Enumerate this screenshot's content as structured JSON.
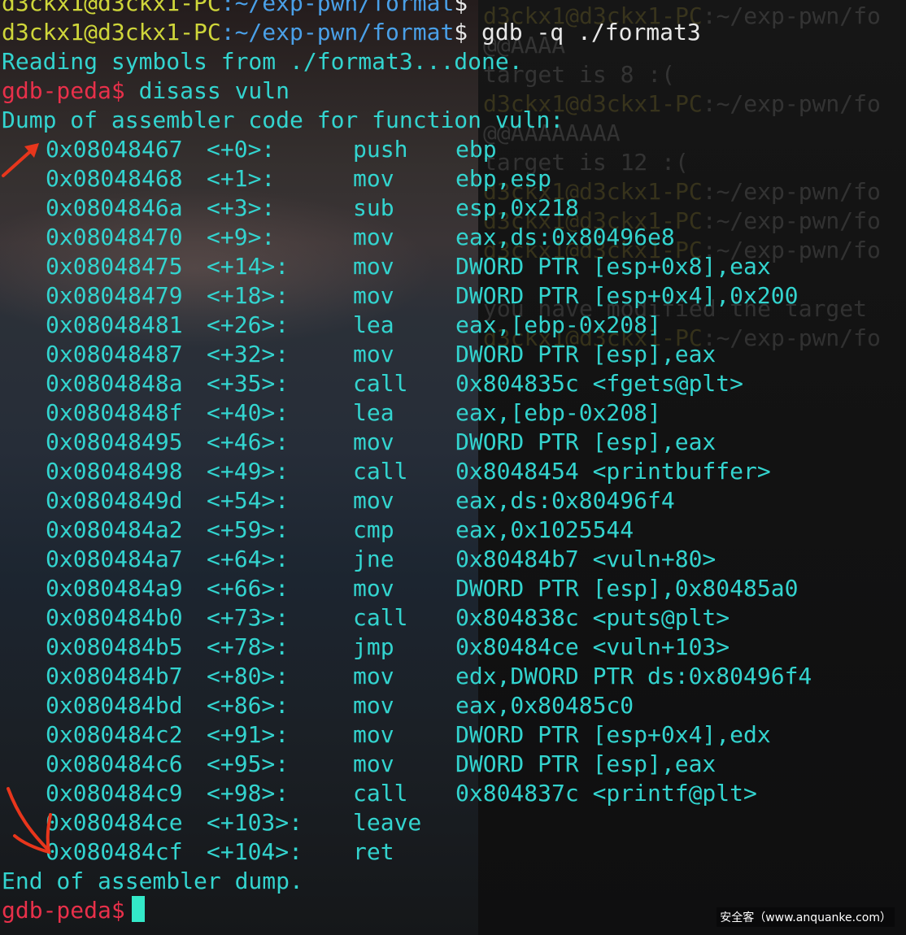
{
  "window": {
    "prev_prompt": {
      "user_host": "d3ckx1@d3ckx1-PC",
      "path": ":~/exp-pwn/format",
      "symbol": "$"
    }
  },
  "session": {
    "prompt": {
      "user_host": "d3ckx1@d3ckx1-PC",
      "path": ":~/exp-pwn/format",
      "symbol": "$"
    },
    "command": " gdb -q ./format3",
    "reading": "Reading symbols from ./format3...done.",
    "gdb_prompt": "gdb-peda$",
    "gdb_command": " disass vuln",
    "dump_header": "Dump of assembler code for function vuln:",
    "dump_footer": "End of assembler dump.",
    "instructions": [
      {
        "addr": "0x08048467",
        "off": "<+0>:",
        "op": "push",
        "args": "ebp"
      },
      {
        "addr": "0x08048468",
        "off": "<+1>:",
        "op": "mov",
        "args": "ebp,esp"
      },
      {
        "addr": "0x0804846a",
        "off": "<+3>:",
        "op": "sub",
        "args": "esp,0x218"
      },
      {
        "addr": "0x08048470",
        "off": "<+9>:",
        "op": "mov",
        "args": "eax,ds:0x80496e8"
      },
      {
        "addr": "0x08048475",
        "off": "<+14>:",
        "op": "mov",
        "args": "DWORD PTR [esp+0x8],eax"
      },
      {
        "addr": "0x08048479",
        "off": "<+18>:",
        "op": "mov",
        "args": "DWORD PTR [esp+0x4],0x200"
      },
      {
        "addr": "0x08048481",
        "off": "<+26>:",
        "op": "lea",
        "args": "eax,[ebp-0x208]"
      },
      {
        "addr": "0x08048487",
        "off": "<+32>:",
        "op": "mov",
        "args": "DWORD PTR [esp],eax"
      },
      {
        "addr": "0x0804848a",
        "off": "<+35>:",
        "op": "call",
        "args": "0x804835c <fgets@plt>"
      },
      {
        "addr": "0x0804848f",
        "off": "<+40>:",
        "op": "lea",
        "args": "eax,[ebp-0x208]"
      },
      {
        "addr": "0x08048495",
        "off": "<+46>:",
        "op": "mov",
        "args": "DWORD PTR [esp],eax"
      },
      {
        "addr": "0x08048498",
        "off": "<+49>:",
        "op": "call",
        "args": "0x8048454 <printbuffer>"
      },
      {
        "addr": "0x0804849d",
        "off": "<+54>:",
        "op": "mov",
        "args": "eax,ds:0x80496f4"
      },
      {
        "addr": "0x080484a2",
        "off": "<+59>:",
        "op": "cmp",
        "args": "eax,0x1025544"
      },
      {
        "addr": "0x080484a7",
        "off": "<+64>:",
        "op": "jne",
        "args": "0x80484b7 <vuln+80>"
      },
      {
        "addr": "0x080484a9",
        "off": "<+66>:",
        "op": "mov",
        "args": "DWORD PTR [esp],0x80485a0"
      },
      {
        "addr": "0x080484b0",
        "off": "<+73>:",
        "op": "call",
        "args": "0x804838c <puts@plt>"
      },
      {
        "addr": "0x080484b5",
        "off": "<+78>:",
        "op": "jmp",
        "args": "0x80484ce <vuln+103>"
      },
      {
        "addr": "0x080484b7",
        "off": "<+80>:",
        "op": "mov",
        "args": "edx,DWORD PTR ds:0x80496f4"
      },
      {
        "addr": "0x080484bd",
        "off": "<+86>:",
        "op": "mov",
        "args": "eax,0x80485c0"
      },
      {
        "addr": "0x080484c2",
        "off": "<+91>:",
        "op": "mov",
        "args": "DWORD PTR [esp+0x4],edx"
      },
      {
        "addr": "0x080484c6",
        "off": "<+95>:",
        "op": "mov",
        "args": "DWORD PTR [esp],eax"
      },
      {
        "addr": "0x080484c9",
        "off": "<+98>:",
        "op": "call",
        "args": "0x804837c <printf@plt>"
      },
      {
        "addr": "0x080484ce",
        "off": "<+103>:",
        "op": "leave",
        "args": ""
      },
      {
        "addr": "0x080484cf",
        "off": "<+104>:",
        "op": "ret",
        "args": ""
      }
    ]
  },
  "ghost_lines": [
    {
      "gp": "d3ckx1@d3ckx1-PC",
      "text": ":~/exp-pwn/fo"
    },
    {
      "gp": "",
      "text": "@@AAAA"
    },
    {
      "gp": "",
      "text": "target is 8 :("
    },
    {
      "gp": "d3ckx1@d3ckx1-PC",
      "text": ":~/exp-pwn/fo"
    },
    {
      "gp": "",
      "text": "@@AAAAAAAA"
    },
    {
      "gp": "",
      "text": "target is 12 :("
    },
    {
      "gp": "d3ckx1@d3ckx1-PC",
      "text": ":~/exp-pwn/fo"
    },
    {
      "gp": "d3ckx1@d3ckx1-PC",
      "text": ":~/exp-pwn/fo"
    },
    {
      "gp": "d3ckx1@d3ckx1-PC",
      "text": ":~/exp-pwn/fo"
    },
    {
      "gp": "",
      "text": ""
    },
    {
      "gp": "",
      "text": "you have modified the target"
    },
    {
      "gp": "d3ckx1@d3ckx1-PC",
      "text": ":~/exp-pwn/fo"
    }
  ],
  "watermark": "安全客（www.anquanke.com）",
  "colors": {
    "prompt": "#e8304a",
    "asm": "#33d4cf",
    "user": "#cfd63a",
    "path": "#4aa0e8",
    "cursor": "#33e8c8",
    "arrow": "#e8361c"
  }
}
